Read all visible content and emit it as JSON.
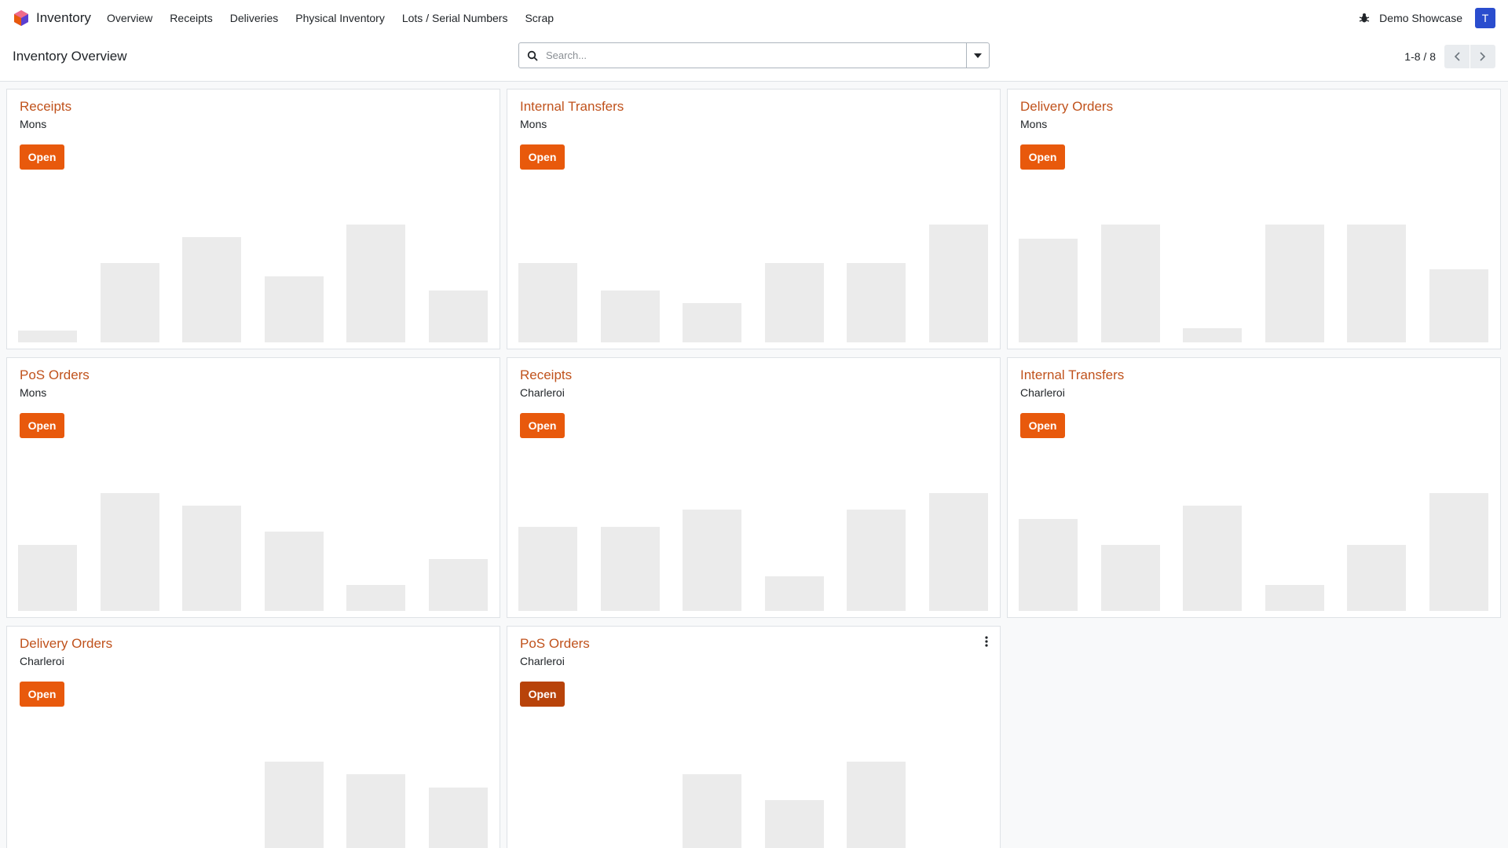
{
  "navbar": {
    "app_name": "Inventory",
    "menu": [
      "Overview",
      "Receipts",
      "Deliveries",
      "Physical Inventory",
      "Lots / Serial Numbers",
      "Scrap"
    ],
    "company": "Demo Showcase",
    "avatar_initial": "T",
    "avatar_color": "#2a4dce"
  },
  "control_panel": {
    "title": "Inventory Overview",
    "search_placeholder": "Search...",
    "pager": "1-8 / 8"
  },
  "colors": {
    "accent": "#e8590c",
    "title": "#c0521c",
    "placeholder_bar": "#ebebeb"
  },
  "cards": [
    {
      "title": "Receipts",
      "subtitle": "Mons",
      "button": "Open",
      "bars": [
        0.1,
        0.67,
        0.89,
        0.56,
        1.0,
        0.44
      ]
    },
    {
      "title": "Internal Transfers",
      "subtitle": "Mons",
      "button": "Open",
      "bars": [
        0.67,
        0.44,
        0.33,
        0.67,
        0.67,
        1.0
      ]
    },
    {
      "title": "Delivery Orders",
      "subtitle": "Mons",
      "button": "Open",
      "bars": [
        0.88,
        1.0,
        0.12,
        1.0,
        1.0,
        0.62
      ]
    },
    {
      "title": "PoS Orders",
      "subtitle": "Mons",
      "button": "Open",
      "bars": [
        0.56,
        1.0,
        0.89,
        0.67,
        0.22,
        0.44
      ]
    },
    {
      "title": "Receipts",
      "subtitle": "Charleroi",
      "button": "Open",
      "bars": [
        0.71,
        0.71,
        0.86,
        0.29,
        0.86,
        1.0
      ]
    },
    {
      "title": "Internal Transfers",
      "subtitle": "Charleroi",
      "button": "Open",
      "bars": [
        0.78,
        0.56,
        0.89,
        0.22,
        0.56,
        1.0
      ]
    },
    {
      "title": "Delivery Orders",
      "subtitle": "Charleroi",
      "button": "Open",
      "bars": [
        0.06,
        0.0,
        0.0,
        1.0,
        0.89,
        0.78
      ]
    },
    {
      "title": "PoS Orders",
      "subtitle": "Charleroi",
      "button": "Open",
      "bars": [
        0.1,
        0.0,
        0.89,
        0.67,
        1.0,
        0.0
      ]
    }
  ]
}
